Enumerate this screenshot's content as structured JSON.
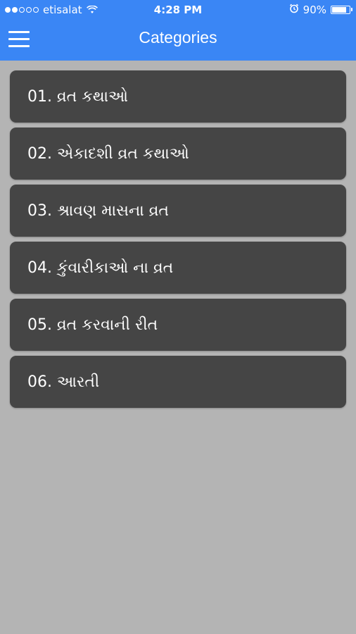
{
  "status_bar": {
    "carrier": "etisalat",
    "time": "4:28 PM",
    "battery": "90%",
    "battery_level": 0.9,
    "icons": [
      "signal-dots-icon",
      "wifi-icon",
      "alarm-icon",
      "battery-icon"
    ]
  },
  "header": {
    "title": "Categories",
    "menu_icon": "hamburger-menu-icon",
    "color": "#3a86f5"
  },
  "categories": [
    {
      "label": "01. વ્રત કથાઓ"
    },
    {
      "label": "02. એકાદશી વ્રત કથાઓ"
    },
    {
      "label": "03. શ્રાવણ માસના વ્રત"
    },
    {
      "label": "04. કુંવારીકાઓ ના વ્રત"
    },
    {
      "label": "05. વ્રત કરવાની રીત"
    },
    {
      "label": "06. આરતી"
    }
  ],
  "colors": {
    "background": "#b4b4b4",
    "card": "#454545",
    "card_text": "#ffffff"
  }
}
